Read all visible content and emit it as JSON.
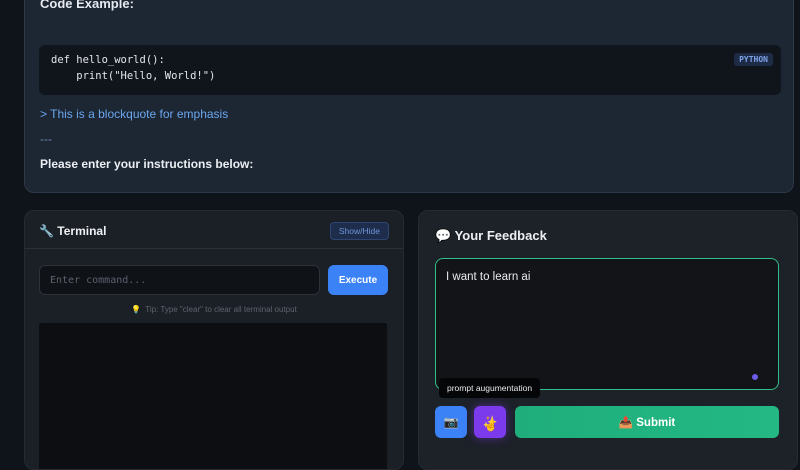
{
  "content": {
    "code_heading": "Code Example:",
    "code_lines": [
      "def hello_world():",
      "    print(\"Hello, World!\")"
    ],
    "code_language": "PYTHON",
    "blockquote": "> This is a blockquote for emphasis",
    "hr": "---",
    "instructions": "Please enter your instructions below:"
  },
  "terminal": {
    "title_icon": "🔧",
    "title": "Terminal",
    "toggle_label": "Show/Hide",
    "input_placeholder": "Enter command...",
    "input_value": "",
    "execute_label": "Execute",
    "tip_icon": "💡",
    "tip": "Tip: Type \"clear\" to clear all terminal output"
  },
  "feedback": {
    "title_icon": "💬",
    "title": "Your Feedback",
    "textarea_value": "I want to learn ai",
    "tooltip": "prompt augumentation",
    "image_icon": "📷",
    "magic_icon": "✨",
    "submit_icon": "📤",
    "submit_label": "Submit"
  },
  "colors": {
    "accent_blue": "#3b82f6",
    "accent_purple": "#7c3aed",
    "accent_green": "#1fae7b",
    "focus_border": "#2fbf8a"
  }
}
